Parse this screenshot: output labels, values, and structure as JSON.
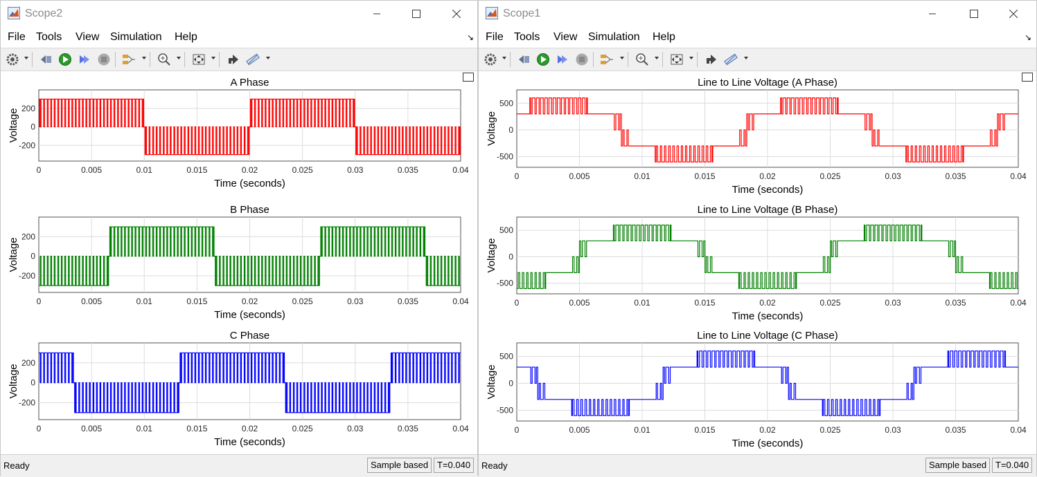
{
  "windows": [
    {
      "title": "Scope2",
      "menu": [
        "File",
        "Tools",
        "View",
        "Simulation",
        "Help"
      ],
      "status": {
        "ready": "Ready",
        "mode": "Sample based",
        "time": "T=0.040"
      }
    },
    {
      "title": "Scope1",
      "menu": [
        "File",
        "Tools",
        "View",
        "Simulation",
        "Help"
      ],
      "status": {
        "ready": "Ready",
        "mode": "Sample based",
        "time": "T=0.040"
      }
    }
  ],
  "chart_data": [
    {
      "type": "line",
      "window": "Scope2",
      "title": "A Phase",
      "xlabel": "Time (seconds)",
      "ylabel": "Voltage",
      "xlim": [
        0,
        0.04
      ],
      "ylim": [
        -370,
        400
      ],
      "yticks": [
        -200,
        0,
        200
      ],
      "xticks": [
        "0",
        "0.005",
        "0.01",
        "0.015",
        "0.02",
        "0.025",
        "0.03",
        "0.035",
        "0.04"
      ],
      "color": "#ff0000",
      "grid": true,
      "waveform": "PWM phase voltage",
      "amplitude": 300,
      "levels": [
        -300,
        0,
        300
      ],
      "period": 0.02,
      "phase_deg": 0
    },
    {
      "type": "line",
      "window": "Scope2",
      "title": "B Phase",
      "xlabel": "Time (seconds)",
      "ylabel": "Voltage",
      "xlim": [
        0,
        0.04
      ],
      "ylim": [
        -370,
        400
      ],
      "yticks": [
        -200,
        0,
        200
      ],
      "xticks": [
        "0",
        "0.005",
        "0.01",
        "0.015",
        "0.02",
        "0.025",
        "0.03",
        "0.035",
        "0.04"
      ],
      "color": "#008000",
      "grid": true,
      "waveform": "PWM phase voltage",
      "amplitude": 300,
      "levels": [
        -300,
        0,
        300
      ],
      "period": 0.02,
      "phase_deg": -120
    },
    {
      "type": "line",
      "window": "Scope2",
      "title": "C Phase",
      "xlabel": "Time (seconds)",
      "ylabel": "Voltage",
      "xlim": [
        0,
        0.04
      ],
      "ylim": [
        -370,
        400
      ],
      "yticks": [
        -200,
        0,
        200
      ],
      "xticks": [
        "0",
        "0.005",
        "0.01",
        "0.015",
        "0.02",
        "0.025",
        "0.03",
        "0.035",
        "0.04"
      ],
      "color": "#0000ff",
      "grid": true,
      "waveform": "PWM phase voltage",
      "amplitude": 300,
      "levels": [
        -300,
        0,
        300
      ],
      "period": 0.02,
      "phase_deg": 120
    },
    {
      "type": "line",
      "window": "Scope1",
      "title": "Line to Line Voltage (A Phase)",
      "xlabel": "Time (seconds)",
      "ylabel": "Voltage",
      "xlim": [
        0,
        0.04
      ],
      "ylim": [
        -700,
        750
      ],
      "yticks": [
        -500,
        0,
        500
      ],
      "xticks": [
        "0",
        "0.005",
        "0.01",
        "0.015",
        "0.02",
        "0.025",
        "0.03",
        "0.035",
        "0.04"
      ],
      "color": "#ff0000",
      "grid": true,
      "waveform": "PWM line-to-line voltage",
      "amplitude": 600,
      "levels": [
        -600,
        -300,
        0,
        300,
        600
      ],
      "period": 0.02,
      "phase_deg": 30
    },
    {
      "type": "line",
      "window": "Scope1",
      "title": "Line to Line Voltage (B Phase)",
      "xlabel": "Time (seconds)",
      "ylabel": "Voltage",
      "xlim": [
        0,
        0.04
      ],
      "ylim": [
        -700,
        750
      ],
      "yticks": [
        -500,
        0,
        500
      ],
      "xticks": [
        "0",
        "0.005",
        "0.01",
        "0.015",
        "0.02",
        "0.025",
        "0.03",
        "0.035",
        "0.04"
      ],
      "color": "#008000",
      "grid": true,
      "waveform": "PWM line-to-line voltage",
      "amplitude": 600,
      "levels": [
        -600,
        -300,
        0,
        300,
        600
      ],
      "period": 0.02,
      "phase_deg": -90
    },
    {
      "type": "line",
      "window": "Scope1",
      "title": "Line to Line Voltage (C Phase)",
      "xlabel": "Time (seconds)",
      "ylabel": "Voltage",
      "xlim": [
        0,
        0.04
      ],
      "ylim": [
        -700,
        750
      ],
      "yticks": [
        -500,
        0,
        500
      ],
      "xticks": [
        "0",
        "0.005",
        "0.01",
        "0.015",
        "0.02",
        "0.025",
        "0.03",
        "0.035",
        "0.04"
      ],
      "color": "#0000ff",
      "grid": true,
      "waveform": "PWM line-to-line voltage",
      "amplitude": 600,
      "levels": [
        -600,
        -300,
        0,
        300,
        600
      ],
      "period": 0.02,
      "phase_deg": 150
    }
  ]
}
